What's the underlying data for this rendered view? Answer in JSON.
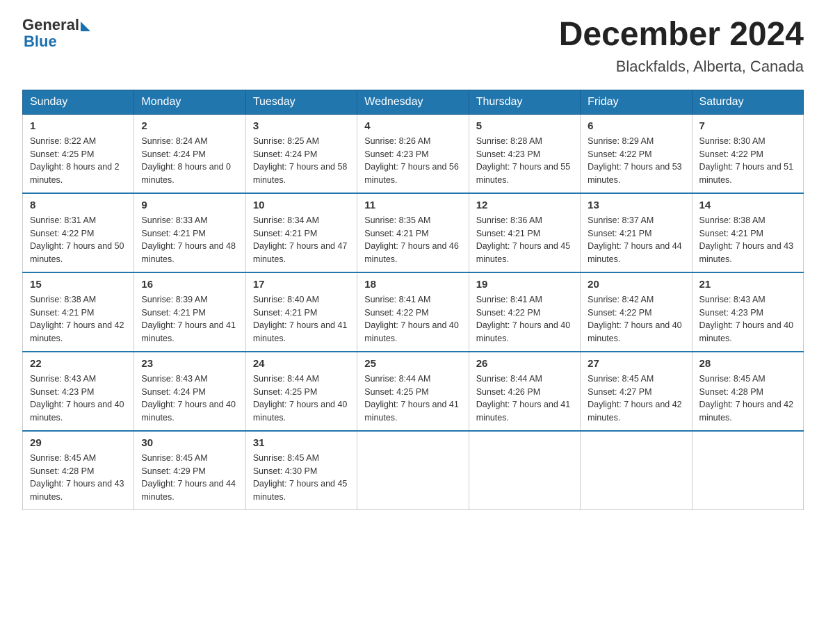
{
  "logo": {
    "text_general": "General",
    "text_blue": "Blue"
  },
  "title": "December 2024",
  "subtitle": "Blackfalds, Alberta, Canada",
  "days_of_week": [
    "Sunday",
    "Monday",
    "Tuesday",
    "Wednesday",
    "Thursday",
    "Friday",
    "Saturday"
  ],
  "weeks": [
    [
      {
        "day": "1",
        "sunrise": "8:22 AM",
        "sunset": "4:25 PM",
        "daylight": "8 hours and 2 minutes."
      },
      {
        "day": "2",
        "sunrise": "8:24 AM",
        "sunset": "4:24 PM",
        "daylight": "8 hours and 0 minutes."
      },
      {
        "day": "3",
        "sunrise": "8:25 AM",
        "sunset": "4:24 PM",
        "daylight": "7 hours and 58 minutes."
      },
      {
        "day": "4",
        "sunrise": "8:26 AM",
        "sunset": "4:23 PM",
        "daylight": "7 hours and 56 minutes."
      },
      {
        "day": "5",
        "sunrise": "8:28 AM",
        "sunset": "4:23 PM",
        "daylight": "7 hours and 55 minutes."
      },
      {
        "day": "6",
        "sunrise": "8:29 AM",
        "sunset": "4:22 PM",
        "daylight": "7 hours and 53 minutes."
      },
      {
        "day": "7",
        "sunrise": "8:30 AM",
        "sunset": "4:22 PM",
        "daylight": "7 hours and 51 minutes."
      }
    ],
    [
      {
        "day": "8",
        "sunrise": "8:31 AM",
        "sunset": "4:22 PM",
        "daylight": "7 hours and 50 minutes."
      },
      {
        "day": "9",
        "sunrise": "8:33 AM",
        "sunset": "4:21 PM",
        "daylight": "7 hours and 48 minutes."
      },
      {
        "day": "10",
        "sunrise": "8:34 AM",
        "sunset": "4:21 PM",
        "daylight": "7 hours and 47 minutes."
      },
      {
        "day": "11",
        "sunrise": "8:35 AM",
        "sunset": "4:21 PM",
        "daylight": "7 hours and 46 minutes."
      },
      {
        "day": "12",
        "sunrise": "8:36 AM",
        "sunset": "4:21 PM",
        "daylight": "7 hours and 45 minutes."
      },
      {
        "day": "13",
        "sunrise": "8:37 AM",
        "sunset": "4:21 PM",
        "daylight": "7 hours and 44 minutes."
      },
      {
        "day": "14",
        "sunrise": "8:38 AM",
        "sunset": "4:21 PM",
        "daylight": "7 hours and 43 minutes."
      }
    ],
    [
      {
        "day": "15",
        "sunrise": "8:38 AM",
        "sunset": "4:21 PM",
        "daylight": "7 hours and 42 minutes."
      },
      {
        "day": "16",
        "sunrise": "8:39 AM",
        "sunset": "4:21 PM",
        "daylight": "7 hours and 41 minutes."
      },
      {
        "day": "17",
        "sunrise": "8:40 AM",
        "sunset": "4:21 PM",
        "daylight": "7 hours and 41 minutes."
      },
      {
        "day": "18",
        "sunrise": "8:41 AM",
        "sunset": "4:22 PM",
        "daylight": "7 hours and 40 minutes."
      },
      {
        "day": "19",
        "sunrise": "8:41 AM",
        "sunset": "4:22 PM",
        "daylight": "7 hours and 40 minutes."
      },
      {
        "day": "20",
        "sunrise": "8:42 AM",
        "sunset": "4:22 PM",
        "daylight": "7 hours and 40 minutes."
      },
      {
        "day": "21",
        "sunrise": "8:43 AM",
        "sunset": "4:23 PM",
        "daylight": "7 hours and 40 minutes."
      }
    ],
    [
      {
        "day": "22",
        "sunrise": "8:43 AM",
        "sunset": "4:23 PM",
        "daylight": "7 hours and 40 minutes."
      },
      {
        "day": "23",
        "sunrise": "8:43 AM",
        "sunset": "4:24 PM",
        "daylight": "7 hours and 40 minutes."
      },
      {
        "day": "24",
        "sunrise": "8:44 AM",
        "sunset": "4:25 PM",
        "daylight": "7 hours and 40 minutes."
      },
      {
        "day": "25",
        "sunrise": "8:44 AM",
        "sunset": "4:25 PM",
        "daylight": "7 hours and 41 minutes."
      },
      {
        "day": "26",
        "sunrise": "8:44 AM",
        "sunset": "4:26 PM",
        "daylight": "7 hours and 41 minutes."
      },
      {
        "day": "27",
        "sunrise": "8:45 AM",
        "sunset": "4:27 PM",
        "daylight": "7 hours and 42 minutes."
      },
      {
        "day": "28",
        "sunrise": "8:45 AM",
        "sunset": "4:28 PM",
        "daylight": "7 hours and 42 minutes."
      }
    ],
    [
      {
        "day": "29",
        "sunrise": "8:45 AM",
        "sunset": "4:28 PM",
        "daylight": "7 hours and 43 minutes."
      },
      {
        "day": "30",
        "sunrise": "8:45 AM",
        "sunset": "4:29 PM",
        "daylight": "7 hours and 44 minutes."
      },
      {
        "day": "31",
        "sunrise": "8:45 AM",
        "sunset": "4:30 PM",
        "daylight": "7 hours and 45 minutes."
      },
      null,
      null,
      null,
      null
    ]
  ]
}
